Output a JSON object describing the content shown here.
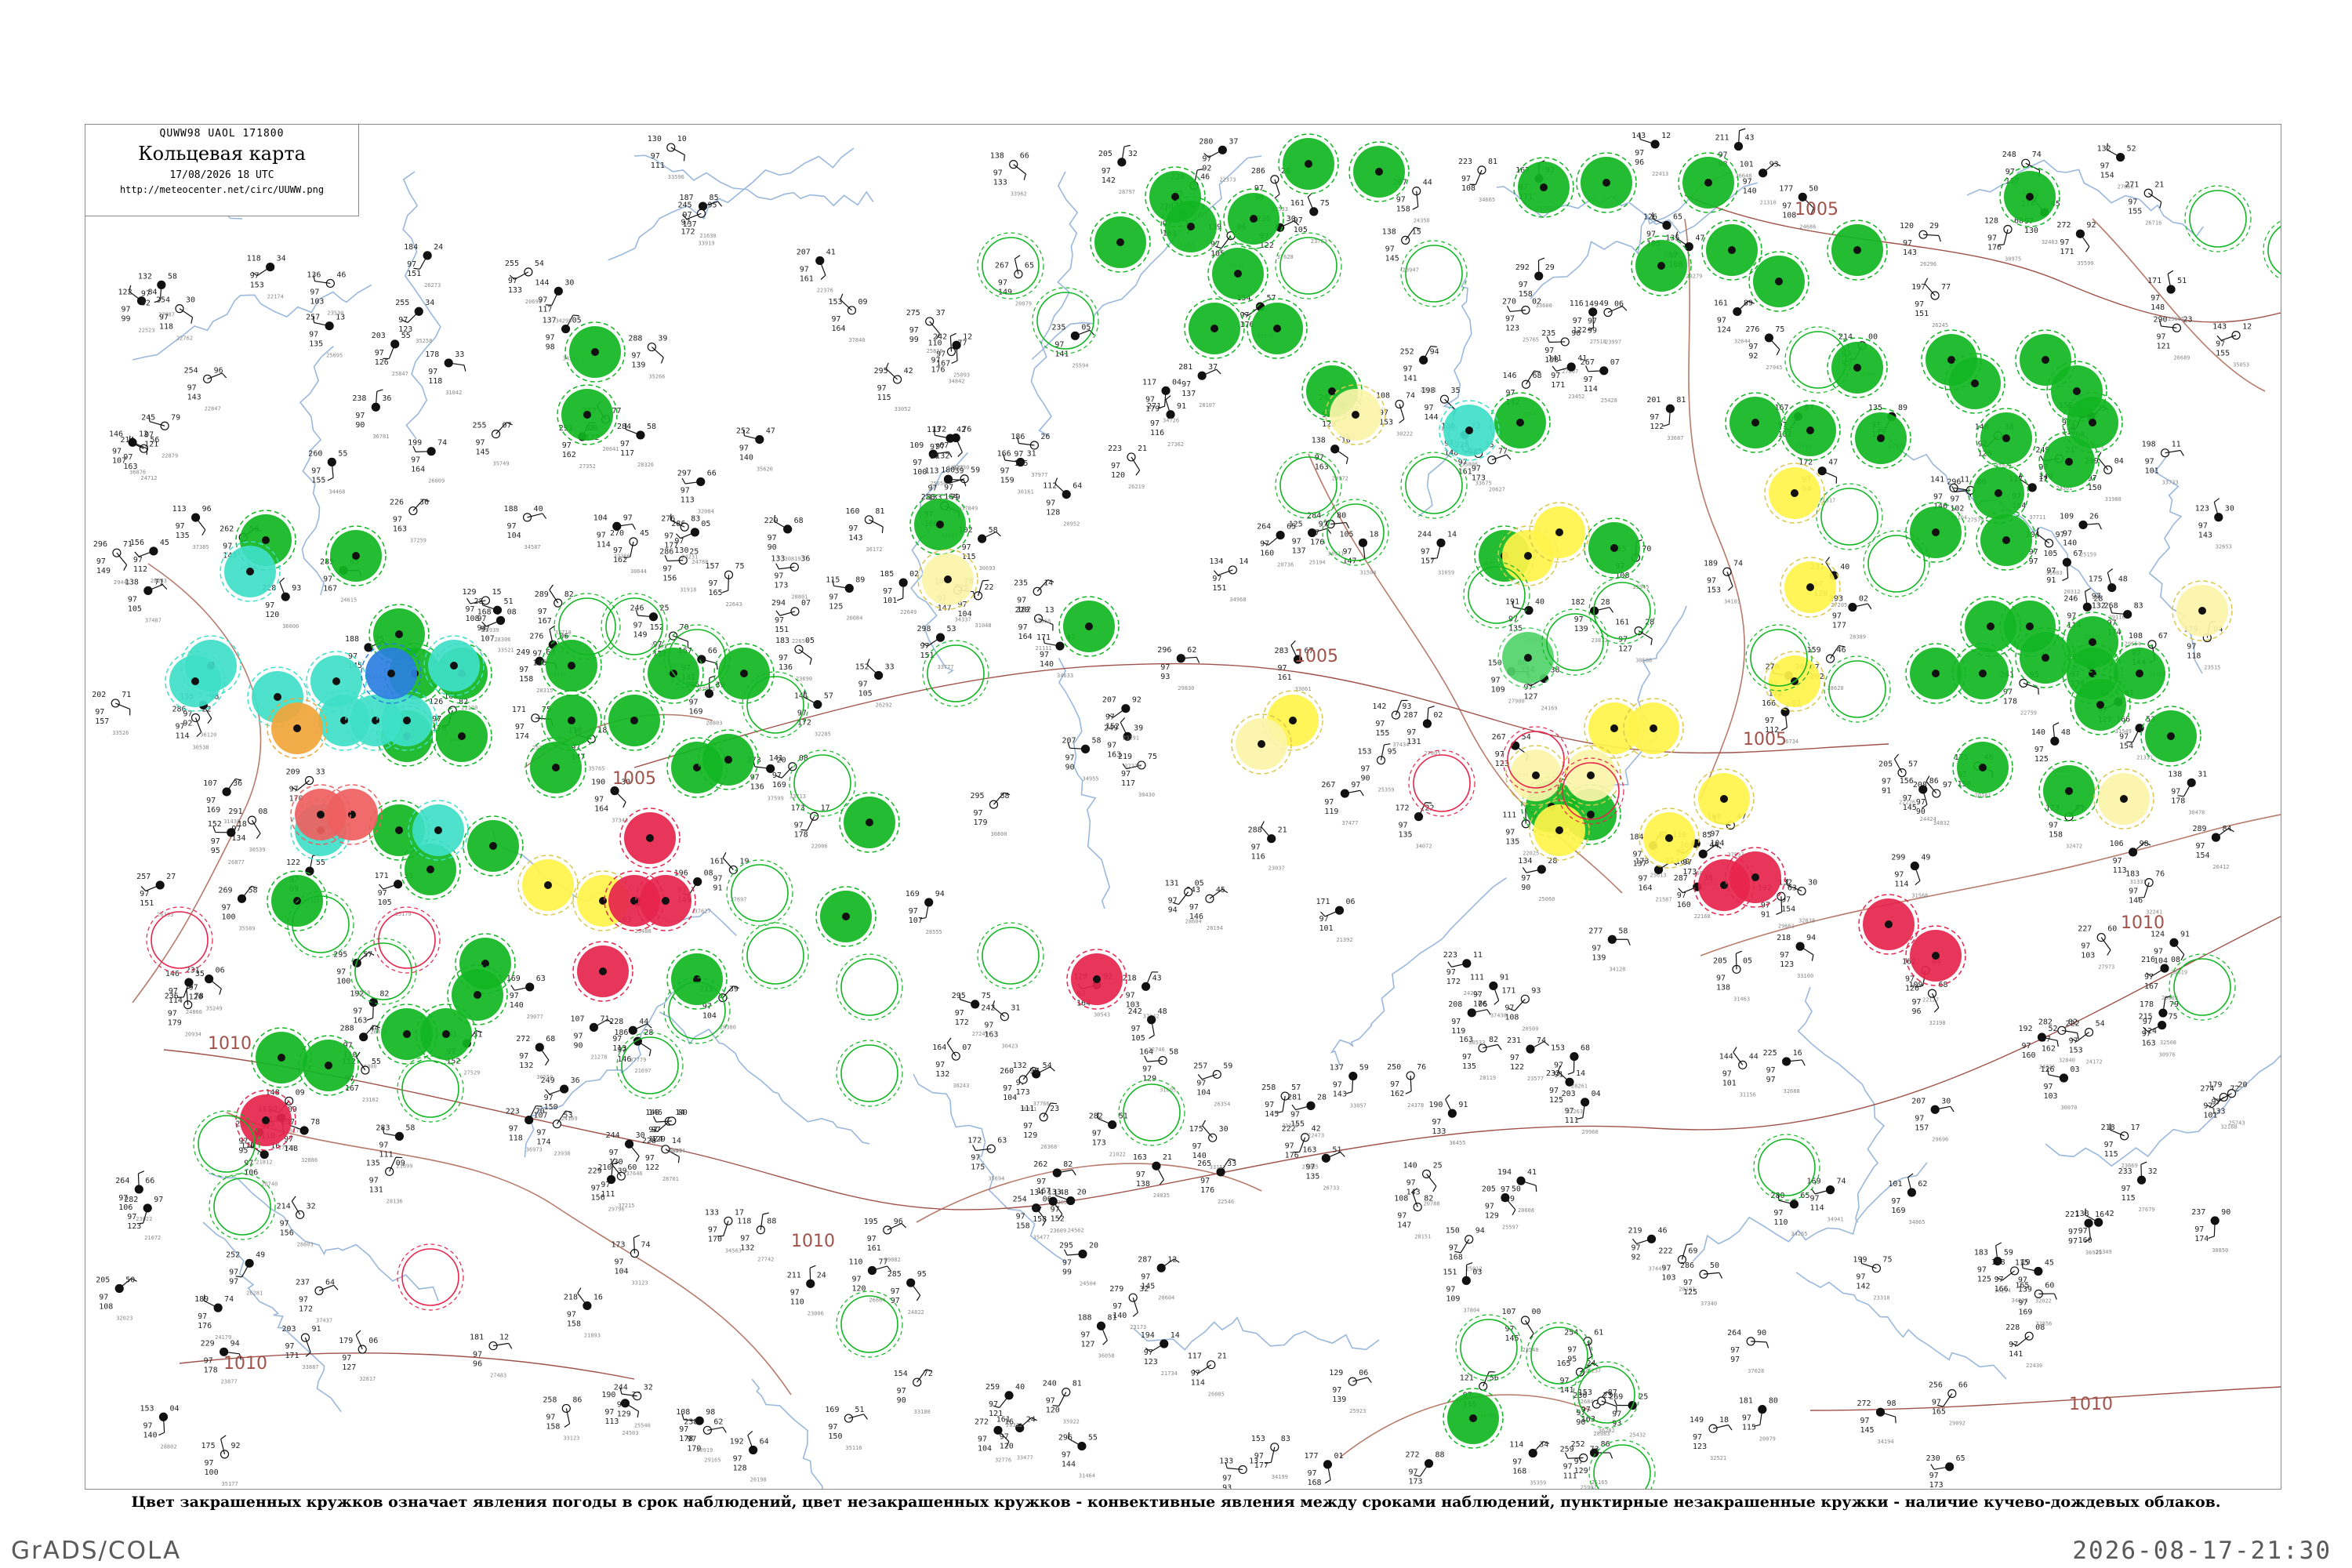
{
  "header": {
    "code": "QUWW98  UAOL  171800",
    "title": "Кольцевая карта",
    "date": "17/08/2026 18 UTC",
    "url": "http://meteocenter.net/circ/UUWW.png"
  },
  "isobars": [
    {
      "label": "1005",
      "pos": "upper-right"
    },
    {
      "label": "1005",
      "pos": "center-left"
    },
    {
      "label": "1005",
      "pos": "center"
    },
    {
      "label": "1005",
      "pos": "center-right"
    },
    {
      "label": "1010",
      "pos": "left"
    },
    {
      "label": "1010",
      "pos": "lower-left"
    },
    {
      "label": "1010",
      "pos": "lower-center"
    },
    {
      "label": "1010",
      "pos": "lower-right"
    },
    {
      "label": "1010",
      "pos": "right"
    }
  ],
  "colors": {
    "green": "#11b622",
    "green_light": "#53d46a",
    "cyan": "#3fe0c8",
    "yellow": "#fff34a",
    "yellow_pale": "#fbf4a8",
    "orange": "#f2a53b",
    "red": "#e6244c",
    "salmon": "#ef6060",
    "blue": "#2a7fe0",
    "river": "#9ab8dc",
    "border": "#b77b6b",
    "isobar": "#a0524a"
  },
  "caption": "Цвет закрашенных кружков означает явления погоды в срок наблюдений, цвет незакрашенных кружков - конвективные явления между сроками наблюдений, пунктирные незакрашенные кружки - наличие кучево-дождевых облаков.",
  "footer": {
    "software": "GrADS/COLA",
    "timestamp": "2026-08-17-21:30"
  }
}
